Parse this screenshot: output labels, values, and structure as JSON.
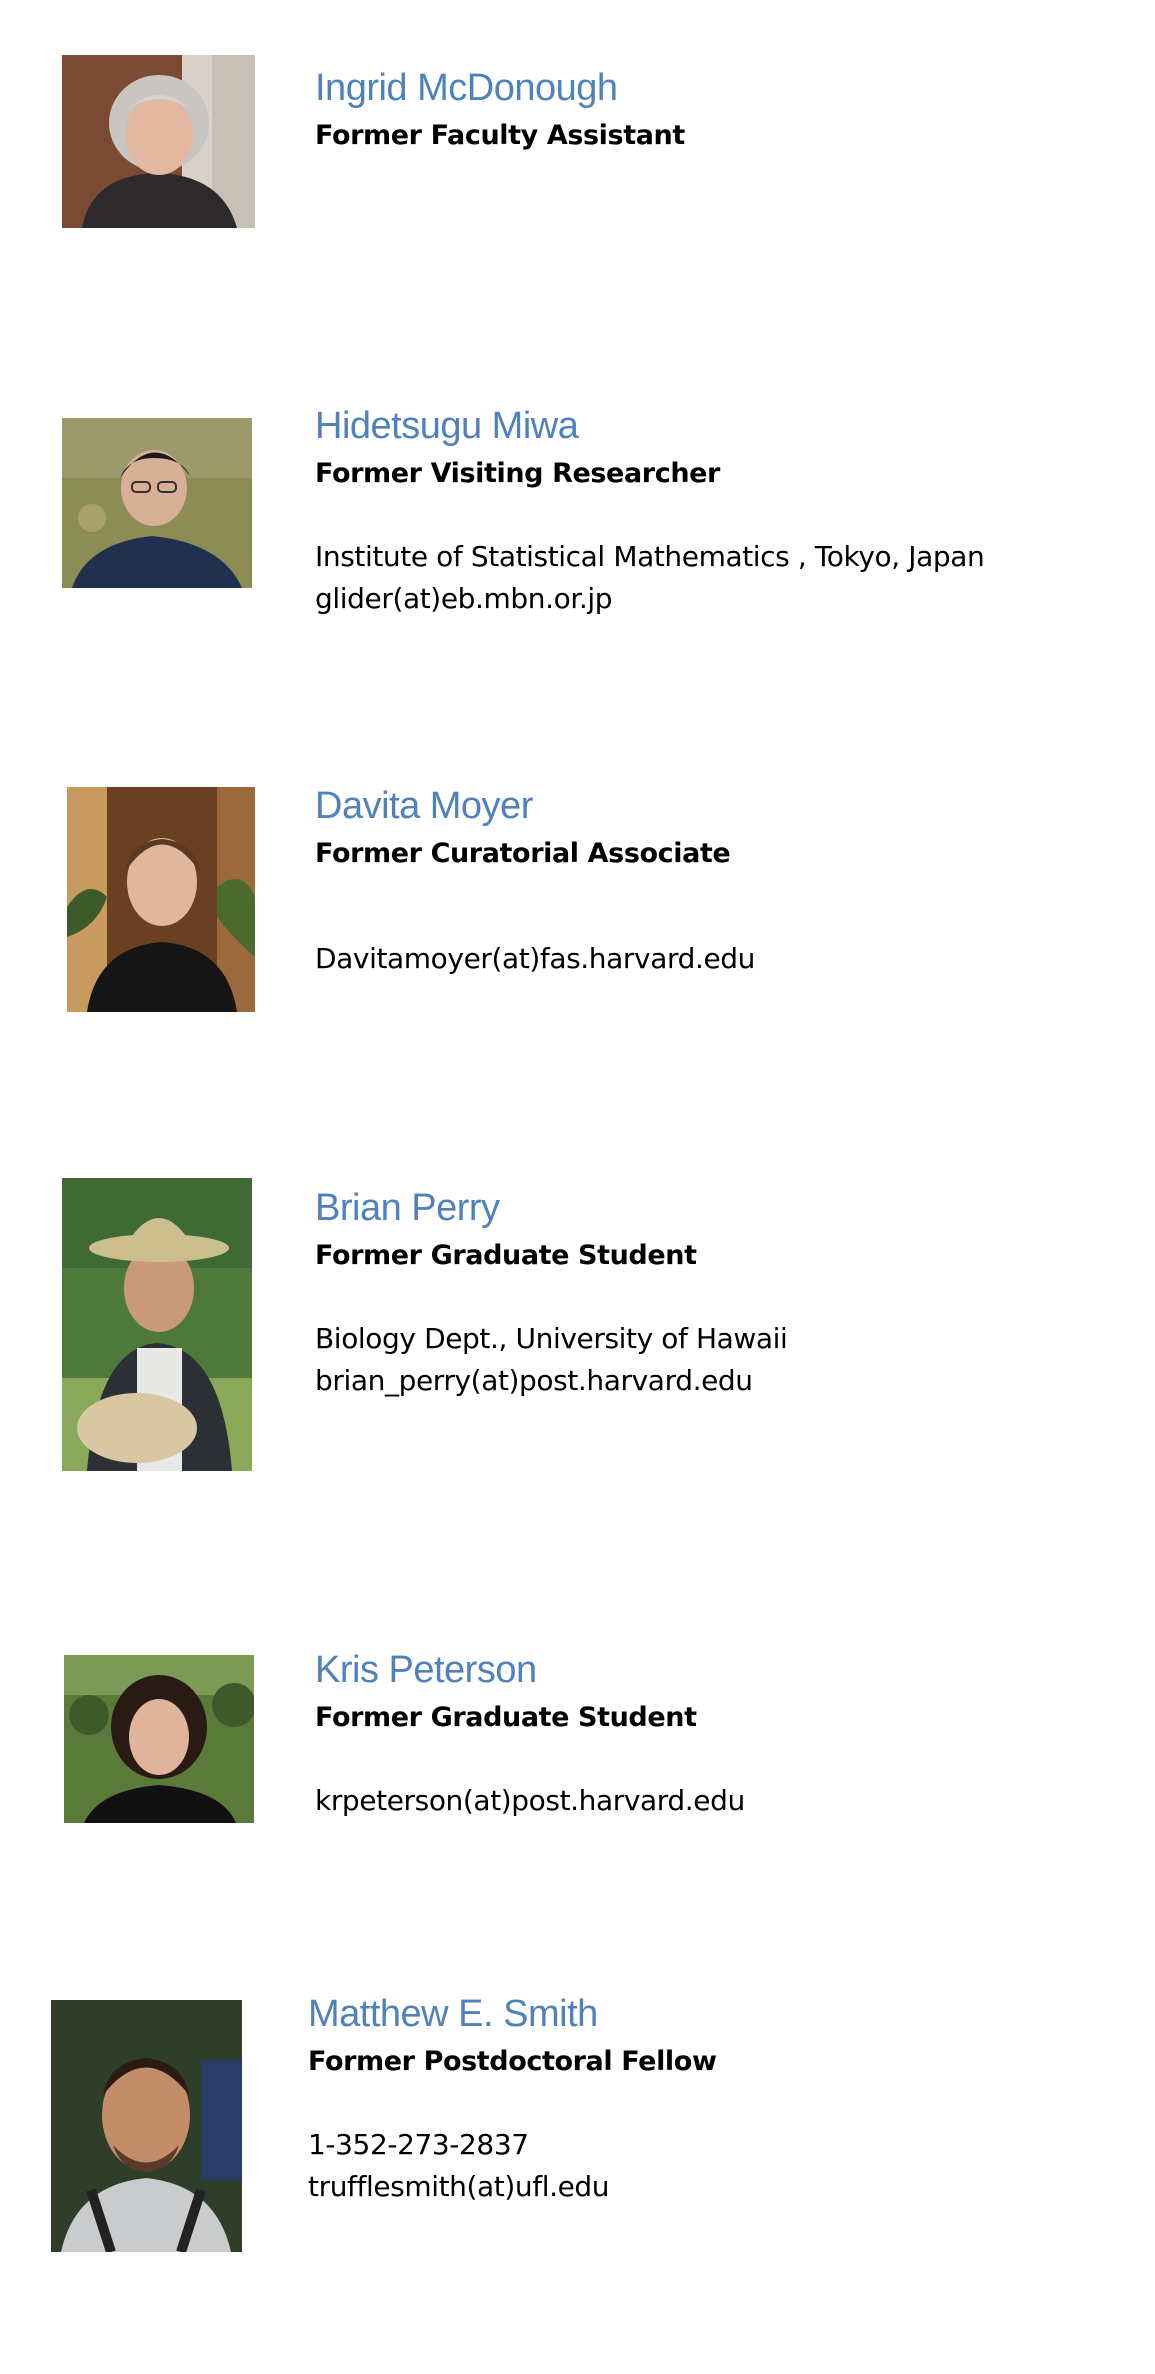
{
  "people": [
    {
      "name": "Ingrid McDonough",
      "role": "Former Faculty Assistant",
      "details": []
    },
    {
      "name": "Hidetsugu Miwa",
      "role": "Former Visiting Researcher",
      "details": [
        "Institute of Statistical Mathematics , Tokyo, Japan",
        "glider(at)eb.mbn.or.jp"
      ]
    },
    {
      "name": "Davita Moyer",
      "role": "Former Curatorial Associate",
      "details": [
        "Davitamoyer(at)fas.harvard.edu"
      ]
    },
    {
      "name": "Brian Perry",
      "role": "Former Graduate Student",
      "details": [
        "Biology Dept., University of Hawaii",
        "brian_perry(at)post.harvard.edu"
      ]
    },
    {
      "name": "Kris Peterson",
      "role": "Former Graduate Student",
      "details": [
        "krpeterson(at)post.harvard.edu"
      ]
    },
    {
      "name": "Matthew E. Smith",
      "role": "Former Postdoctoral Fellow",
      "details": [
        "1-352-273-2837",
        "trufflesmith(at)ufl.edu"
      ]
    }
  ]
}
